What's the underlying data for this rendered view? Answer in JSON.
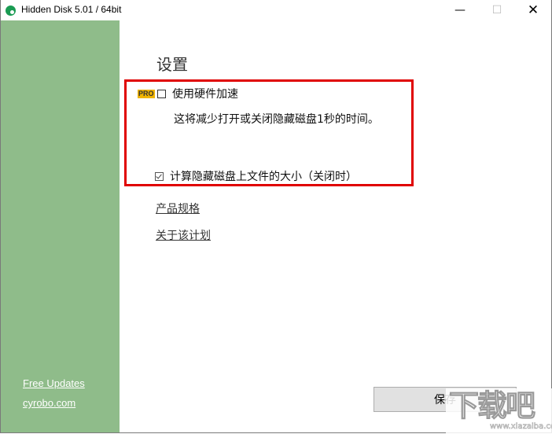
{
  "window": {
    "title": "Hidden Disk 5.01 / 64bit",
    "controls": {
      "minimize": "—",
      "maximize": "☐",
      "close": "✕"
    }
  },
  "sidebar": {
    "color": "#8fbc8a",
    "links": [
      {
        "label": "Free Updates"
      },
      {
        "label": "cyrobo.com"
      }
    ]
  },
  "main": {
    "heading": "设置",
    "options": [
      {
        "badge": "PRO",
        "label": "使用硬件加速",
        "checked": false,
        "description": "这将减少打开或关闭隐藏磁盘1秒的时间。"
      },
      {
        "label": "计算隐藏磁盘上文件的大小（关闭时）",
        "checked": true
      }
    ],
    "links": [
      {
        "label": "产品规格"
      },
      {
        "label": "关于该计划"
      }
    ],
    "save_label": "保存"
  },
  "watermark": {
    "logo": "下载吧",
    "url": "www.xiazaiba.com"
  },
  "colors": {
    "highlight_box": "#e00000",
    "pro_badge": "#f0b400",
    "app_icon": "#1a9b53"
  }
}
